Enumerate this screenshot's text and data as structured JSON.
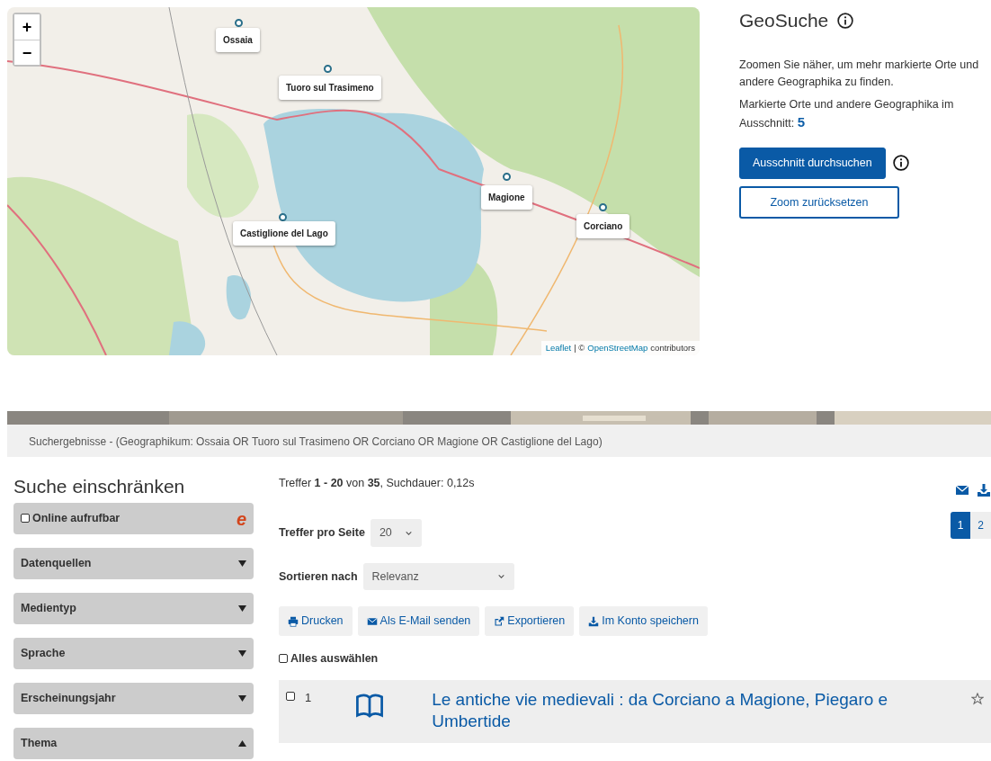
{
  "map": {
    "zoom_controls": [
      "+",
      "−"
    ],
    "markers": [
      {
        "label": "Ossaia"
      },
      {
        "label": "Tuoro sul Trasimeno"
      },
      {
        "label": "Castiglione del Lago"
      },
      {
        "label": "Magione"
      },
      {
        "label": "Corciano"
      }
    ],
    "attribution": [
      {
        "kind": "link",
        "text": "Leaflet"
      },
      {
        "kind": "text",
        "text": "| ©"
      },
      {
        "kind": "link",
        "text": "OpenStreetMap"
      },
      {
        "kind": "text",
        "text": "contributors"
      }
    ]
  },
  "geosearch": {
    "title": "GeoSuche",
    "hint": "Zoomen Sie näher, um mehr markierte Orte und andere Geographika zu finden.",
    "count_label": "Markierte Orte und andere Geographika im Ausschnitt:",
    "count": "5",
    "buttons": [
      {
        "kind": "primary",
        "label": "Ausschnitt durchsuchen"
      },
      {
        "kind": "outline",
        "label": "Zoom zurücksetzen"
      }
    ]
  },
  "breadcrumb": "Suchergebnisse - (Geographikum: Ossaia OR Tuoro sul Trasimeno OR Corciano OR Magione OR Castiglione del Lago)",
  "sidebar": {
    "title": "Suche einschränken",
    "facets": [
      {
        "kind": "checkbox",
        "label": "Online aufrufbar",
        "checked": false,
        "badge": "e"
      },
      {
        "kind": "collapsible",
        "label": "Datenquellen",
        "expanded": false
      },
      {
        "kind": "collapsible",
        "label": "Medientyp",
        "expanded": false
      },
      {
        "kind": "collapsible",
        "label": "Sprache",
        "expanded": false
      },
      {
        "kind": "collapsible",
        "label": "Erscheinungsjahr",
        "expanded": false
      },
      {
        "kind": "collapsible",
        "label": "Thema",
        "expanded": true
      }
    ]
  },
  "results": {
    "summary": "Treffer **1 - 20** von **35**, Suchdauer: 0,12s",
    "per_page": {
      "label": "Treffer pro Seite",
      "value": "20"
    },
    "sort": {
      "label": "Sortieren nach",
      "value": "Relevanz"
    },
    "pages": [
      {
        "label": "1",
        "selected": true
      },
      {
        "label": "2",
        "selected": false
      }
    ],
    "actions": [
      {
        "kind": "print",
        "label": "Drucken"
      },
      {
        "kind": "mail",
        "label": "Als E-Mail senden"
      },
      {
        "kind": "export",
        "label": "Exportieren"
      },
      {
        "kind": "download",
        "label": "Im Konto speichern"
      }
    ],
    "select_all": {
      "label": "Alles auswählen",
      "checked": false
    },
    "items": [
      {
        "number": "1",
        "checked": false,
        "title": "Le antiche vie medievali : da Corciano a Magione, Piegaro e Umbertide"
      }
    ]
  }
}
